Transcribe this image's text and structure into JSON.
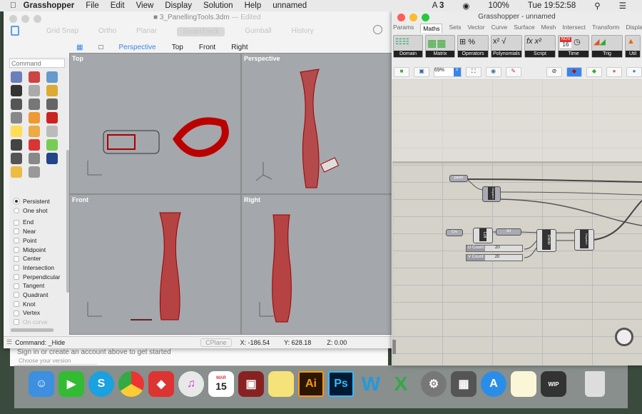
{
  "menubar": {
    "app": "Grasshopper",
    "items": [
      "File",
      "Edit",
      "View",
      "Display",
      "Solution",
      "Help",
      "unnamed"
    ],
    "status": {
      "adobe": "3",
      "battery": "100%",
      "clock": "Tue 19:52:58"
    }
  },
  "rhino": {
    "title": "3_PanellingTools.3dm",
    "edited": "— Edited",
    "toolbar": [
      "Grid Snap",
      "Ortho",
      "Planar",
      "SmartTrack",
      "Gumball",
      "History"
    ],
    "view_tabs": [
      "Perspective",
      "Top",
      "Front",
      "Right"
    ],
    "command_placeholder": "Command",
    "osnap_modes": [
      "Persistent",
      "One shot"
    ],
    "osnaps": [
      "End",
      "Near",
      "Point",
      "Midpoint",
      "Center",
      "Intersection",
      "Perpendicular",
      "Tangent",
      "Quadrant",
      "Knot",
      "Vertex",
      "On curve"
    ],
    "viewports": [
      "Top",
      "Perspective",
      "Front",
      "Right"
    ],
    "status": {
      "command": "Command: _Hide",
      "cplane": "CPlane",
      "x": "X: -186.54",
      "y": "Y: 628.18",
      "z": "Z: 0.00"
    },
    "below_text": "Sign in or create an account above to get started",
    "below_select": "Choose your version"
  },
  "gh": {
    "title": "Grasshopper - unnamed",
    "tabs": [
      "Params",
      "Maths",
      "Sets",
      "Vector",
      "Curve",
      "Surface",
      "Mesh",
      "Intersect",
      "Transform",
      "Display"
    ],
    "active_tab": "Maths",
    "groups": [
      "Domain",
      "Matrix",
      "Operators",
      "Polynomials",
      "Script",
      "Time",
      "Trig",
      "Util"
    ],
    "calendar_icon": {
      "month": "NOV",
      "day": "16"
    },
    "zoom": "69%",
    "nodes": {
      "panel": "panel",
      "crv": "Crv",
      "loft": "Loft",
      "srf": "Srf",
      "divide": "Divide",
      "dispatch": "Dispatch",
      "ucount": "U Count",
      "vcount": "V Count",
      "slider_value": "20"
    }
  },
  "dock": {
    "calendar": {
      "month": "MAR",
      "day": "15"
    },
    "apps": [
      "Finder",
      "FaceTime",
      "Skype",
      "Chrome",
      "SketchUp",
      "iTunes",
      "Calendar",
      "Photo Booth",
      "Stickies",
      "Illustrator",
      "Photoshop",
      "Word",
      "Excel",
      "System Preferences",
      "Calculator",
      "App Store",
      "Notes",
      "Rhino WIP",
      "Trash"
    ],
    "ai": "Ai",
    "ps": "Ps",
    "wip": "WIP"
  }
}
